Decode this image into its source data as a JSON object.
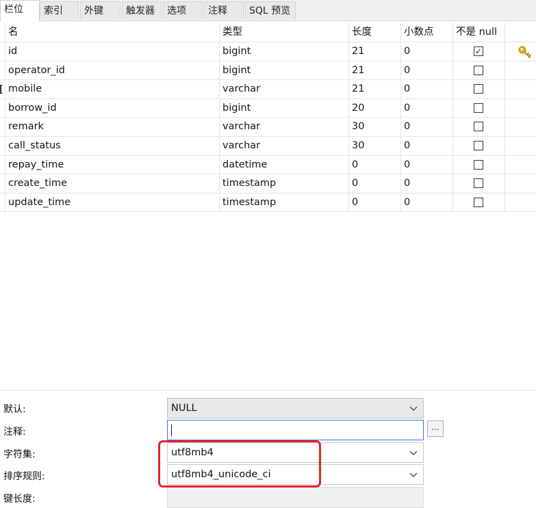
{
  "tabs": [
    {
      "label": "栏位",
      "active": true
    },
    {
      "label": "索引",
      "active": false
    },
    {
      "label": "外键",
      "active": false
    },
    {
      "label": "触发器",
      "active": false
    },
    {
      "label": "选项",
      "active": false
    },
    {
      "label": "注释",
      "active": false
    },
    {
      "label": "SQL 预览",
      "active": false
    }
  ],
  "grid": {
    "headers": {
      "name": "名",
      "type": "类型",
      "length": "长度",
      "decimals": "小数点",
      "not_null": "不是 null"
    },
    "rows": [
      {
        "name": "id",
        "type": "bigint",
        "length": "21",
        "decimals": "0",
        "not_null": true,
        "primary_key": true
      },
      {
        "name": "operator_id",
        "type": "bigint",
        "length": "21",
        "decimals": "0",
        "not_null": false
      },
      {
        "name": "mobile",
        "type": "varchar",
        "length": "21",
        "decimals": "0",
        "not_null": false,
        "selected": true
      },
      {
        "name": "borrow_id",
        "type": "bigint",
        "length": "20",
        "decimals": "0",
        "not_null": false
      },
      {
        "name": "remark",
        "type": "varchar",
        "length": "30",
        "decimals": "0",
        "not_null": false
      },
      {
        "name": "call_status",
        "type": "varchar",
        "length": "30",
        "decimals": "0",
        "not_null": false
      },
      {
        "name": "repay_time",
        "type": "datetime",
        "length": "0",
        "decimals": "0",
        "not_null": false
      },
      {
        "name": "create_time",
        "type": "timestamp",
        "length": "0",
        "decimals": "0",
        "not_null": false
      },
      {
        "name": "update_time",
        "type": "timestamp",
        "length": "0",
        "decimals": "0",
        "not_null": false
      }
    ]
  },
  "properties": {
    "default": {
      "label": "默认:",
      "value": "NULL"
    },
    "comment": {
      "label": "注释:",
      "value": "",
      "ellipsis": "..."
    },
    "charset": {
      "label": "字符集:",
      "value": "utf8mb4"
    },
    "collation": {
      "label": "排序规则:",
      "value": "utf8mb4_unicode_ci"
    },
    "key_length": {
      "label": "键长度:",
      "value": ""
    }
  },
  "colors": {
    "highlight": "#e0242b",
    "focus_border": "#2f7bd8",
    "key_icon": "#e6b21a"
  }
}
